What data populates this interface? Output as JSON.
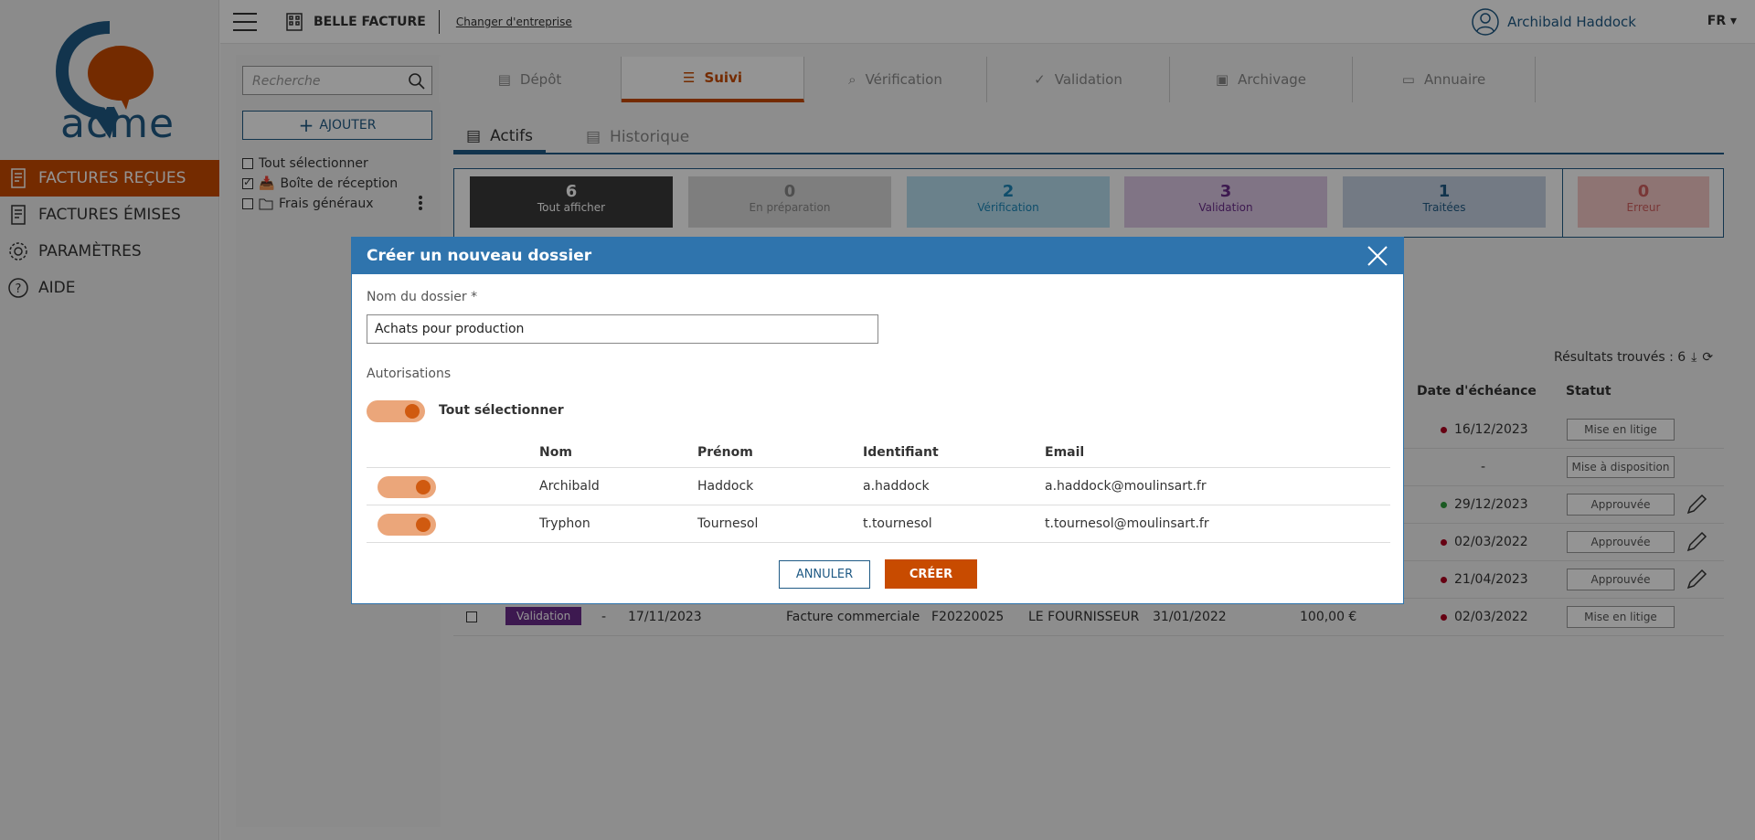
{
  "brand": {
    "logo_text": "acme",
    "accent": "#c84b00",
    "primary": "#1f5a85",
    "modal_header": "#2f74ad"
  },
  "sidebar": {
    "items": [
      {
        "label": "FACTURES REÇUES",
        "icon": "invoice-received-icon",
        "active": true
      },
      {
        "label": "FACTURES ÉMISES",
        "icon": "invoice-sent-icon",
        "active": false
      },
      {
        "label": "PARAMÈTRES",
        "icon": "gear-icon",
        "active": false
      },
      {
        "label": "AIDE",
        "icon": "help-icon",
        "active": false
      }
    ]
  },
  "topbar": {
    "company": "BELLE FACTURE",
    "change_company": "Changer d'entreprise",
    "user": "Archibald Haddock",
    "lang": "FR"
  },
  "left_panel": {
    "search_placeholder": "Recherche",
    "add_label": "AJOUTER",
    "folders": [
      {
        "label": "Tout sélectionner",
        "checked": false,
        "icon": ""
      },
      {
        "label": "Boîte de réception",
        "checked": true,
        "icon": "inbox-icon"
      },
      {
        "label": "Frais généraux",
        "checked": false,
        "icon": "folder-icon"
      }
    ]
  },
  "main_tabs": [
    {
      "label": "Dépôt",
      "icon": "upload-icon"
    },
    {
      "label": "Suivi",
      "icon": "list-icon",
      "active": true
    },
    {
      "label": "Vérification",
      "icon": "search-icon"
    },
    {
      "label": "Validation",
      "icon": "check-circle-icon"
    },
    {
      "label": "Archivage",
      "icon": "archive-icon"
    },
    {
      "label": "Annuaire",
      "icon": "folder-icon"
    }
  ],
  "sub_tabs": [
    {
      "label": "Actifs",
      "active": true
    },
    {
      "label": "Historique",
      "active": false
    }
  ],
  "counters": [
    {
      "num": "6",
      "label": "Tout afficher",
      "bg": "#3a3a3a",
      "color": "#ffffff"
    },
    {
      "num": "0",
      "label": "En préparation",
      "bg": "#d9d9d9",
      "color": "#888888"
    },
    {
      "num": "2",
      "label": "Vérification",
      "bg": "#b7dff0",
      "color": "#1a86b8"
    },
    {
      "num": "3",
      "label": "Validation",
      "bg": "#dcc9e6",
      "color": "#6a2c8a"
    },
    {
      "num": "1",
      "label": "Traitées",
      "bg": "#c6d2e3",
      "color": "#1f5a85"
    },
    {
      "num": "0",
      "label": "Erreur",
      "bg": "#f4c9c6",
      "color": "#d06060"
    }
  ],
  "results": {
    "label": "Résultats trouvés : 6"
  },
  "table": {
    "headers": {
      "due_date": "Date d'échéance",
      "status": "Statut"
    },
    "rows": [
      {
        "due": "16/12/2023",
        "dot": "#b00020",
        "status": "Mise en litige",
        "edit": false
      },
      {
        "due": "-",
        "dot": "",
        "status": "Mise à disposition",
        "edit": false
      },
      {
        "due": "29/12/2023",
        "dot": "#2e9c3c",
        "status": "Approuvée",
        "edit": true
      },
      {
        "due": "02/03/2022",
        "dot": "#b00020",
        "status": "Approuvée",
        "edit": true
      },
      {
        "due": "21/04/2023",
        "dot": "#b00020",
        "status": "Approuvée",
        "edit": true
      }
    ],
    "last_row": {
      "badge": "Validation",
      "dash": "-",
      "date": "17/11/2023",
      "type": "Facture commerciale",
      "ref": "F20220025",
      "supplier": "LE FOURNISSEUR",
      "date2": "31/01/2022",
      "amount": "100,00 €",
      "due": "02/03/2022",
      "status": "Mise en litige"
    }
  },
  "modal": {
    "title": "Créer un nouveau dossier",
    "name_label": "Nom du dossier *",
    "name_value": "Achats pour production",
    "permissions_label": "Autorisations",
    "select_all_label": "Tout sélectionner",
    "columns": {
      "nom": "Nom",
      "prenom": "Prénom",
      "identifiant": "Identifiant",
      "email": "Email"
    },
    "users": [
      {
        "nom": "Archibald",
        "prenom": "Haddock",
        "identifiant": "a.haddock",
        "email": "a.haddock@moulinsart.fr",
        "enabled": true
      },
      {
        "nom": "Tryphon",
        "prenom": "Tournesol",
        "identifiant": "t.tournesol",
        "email": "t.tournesol@moulinsart.fr",
        "enabled": true
      }
    ],
    "cancel_label": "ANNULER",
    "create_label": "CRÉER"
  }
}
